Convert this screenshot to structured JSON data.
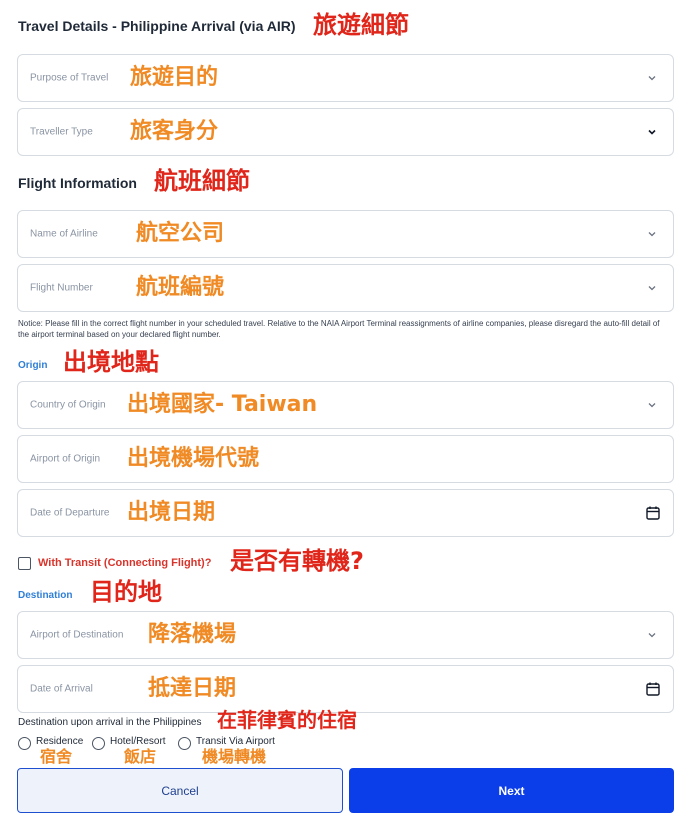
{
  "travel": {
    "title": "Travel Details - Philippine Arrival (via AIR)",
    "title_cn": "旅遊細節",
    "purpose": {
      "placeholder": "Purpose of Travel",
      "cn": "旅遊目的"
    },
    "traveller_type": {
      "placeholder": "Traveller Type",
      "cn": "旅客身分"
    }
  },
  "flight": {
    "title": "Flight Information",
    "title_cn": "航班細節",
    "airline": {
      "placeholder": "Name of Airline",
      "cn": "航空公司"
    },
    "flight_number": {
      "placeholder": "Flight Number",
      "cn": "航班編號"
    },
    "notice": "Notice: Please fill in the correct flight number in your scheduled travel. Relative to the NAIA Airport Terminal reassignments of airline companies, please disregard the auto-fill detail of the airport terminal based on your declared flight number."
  },
  "origin": {
    "label": "Origin",
    "label_cn": "出境地點",
    "country": {
      "placeholder": "Country of Origin",
      "cn": "出境國家- Taiwan"
    },
    "airport": {
      "placeholder": "Airport of Origin",
      "cn": "出境機場代號"
    },
    "departure_date": {
      "placeholder": "Date of Departure",
      "cn": "出境日期"
    }
  },
  "transit": {
    "label": "With Transit (Connecting Flight)?",
    "cn": "是否有轉機?",
    "checked": false
  },
  "destination": {
    "label": "Destination",
    "label_cn": "目的地",
    "airport": {
      "placeholder": "Airport of Destination",
      "cn": "降落機場"
    },
    "arrival_date": {
      "placeholder": "Date of Arrival",
      "cn": "抵達日期"
    },
    "upon_arrival": {
      "label": "Destination upon arrival in the Philippines",
      "cn": "在菲律賓的住宿",
      "options": [
        {
          "label": "Residence",
          "cn": "宿舍"
        },
        {
          "label": "Hotel/Resort",
          "cn": "飯店"
        },
        {
          "label": "Transit Via Airport",
          "cn": "機場轉機"
        }
      ]
    }
  },
  "buttons": {
    "cancel": "Cancel",
    "next": "Next"
  },
  "colors": {
    "annotation_red": "#e0261a",
    "annotation_orange": "#f08a24",
    "accent_blue": "#2f7fd6",
    "primary_button": "#0b3ee8",
    "transit_red": "#d9342b"
  },
  "icons": {
    "dropdown": "chevron-down-icon",
    "date": "calendar-icon"
  }
}
